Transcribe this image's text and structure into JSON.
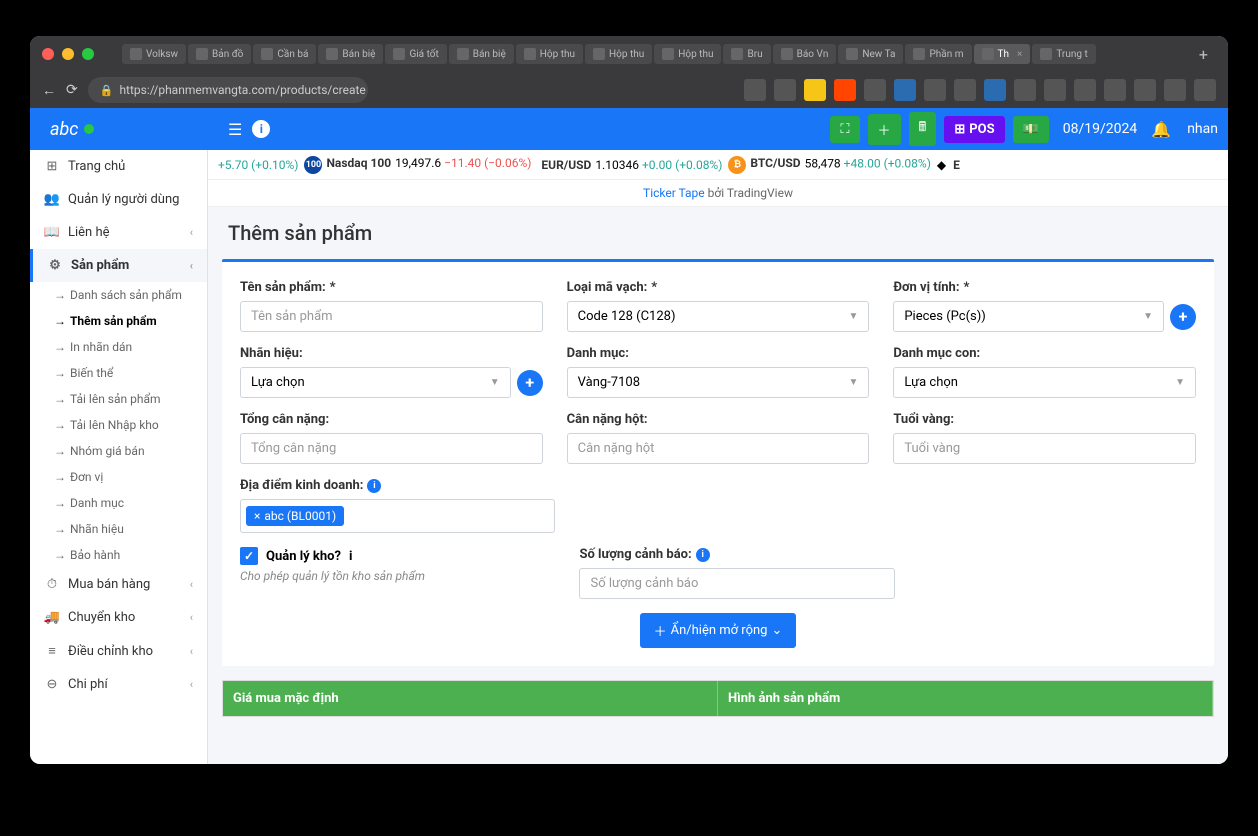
{
  "browser": {
    "tabs": [
      "Volksw",
      "Bản đồ",
      "Cần bá",
      "Bán biệ",
      "Giá tốt",
      "Bán biệ",
      "Hộp thu",
      "Hộp thu",
      "Hộp thu",
      "Bru",
      "Báo Vn",
      "New Ta",
      "Phần m",
      "Th",
      "Trung t"
    ],
    "active_tab_index": 13,
    "url": "https://phanmemvangta.com/products/create"
  },
  "header": {
    "logo": "abc",
    "date": "08/19/2024",
    "user": "nhan",
    "pos_label": "POS"
  },
  "ticker": {
    "items": [
      {
        "change": "+5.70",
        "pct": "(+0.10%)",
        "cls": "up"
      },
      {
        "badge": "100",
        "sym": "Nasdaq 100",
        "price": "19,497.6",
        "change": "−11.40",
        "pct": "(−0.06%)",
        "cls": "down"
      },
      {
        "sym": "EUR/USD",
        "price": "1.10346",
        "change": "+0.00",
        "pct": "(+0.08%)",
        "cls": "up"
      },
      {
        "badge": "₿",
        "sym": "BTC/USD",
        "price": "58,478",
        "change": "+48.00",
        "pct": "(+0.08%)",
        "cls": "up"
      }
    ],
    "caption_link": "Ticker Tape",
    "caption_rest": " bởi TradingView"
  },
  "sidebar": {
    "items": [
      {
        "icon": "⊞",
        "label": "Trang chủ"
      },
      {
        "icon": "👥",
        "label": "Quản lý người dùng"
      },
      {
        "icon": "📖",
        "label": "Liên hệ",
        "chev": true
      },
      {
        "icon": "⚙",
        "label": "Sản phẩm",
        "chev": true,
        "active": true
      },
      {
        "icon": "⏱",
        "label": "Mua bán hàng",
        "chev": true
      },
      {
        "icon": "🚚",
        "label": "Chuyển kho",
        "chev": true
      },
      {
        "icon": "≡",
        "label": "Điều chỉnh kho",
        "chev": true
      },
      {
        "icon": "⊖",
        "label": "Chi phí",
        "chev": true
      }
    ],
    "subs": [
      {
        "label": "Danh sách sản phẩm"
      },
      {
        "label": "Thêm sản phẩm",
        "active": true
      },
      {
        "label": "In nhãn dán"
      },
      {
        "label": "Biến thể"
      },
      {
        "label": "Tải lên sản phẩm"
      },
      {
        "label": "Tải lên Nhập kho"
      },
      {
        "label": "Nhóm giá bán"
      },
      {
        "label": "Đơn vị"
      },
      {
        "label": "Danh mục"
      },
      {
        "label": "Nhãn hiệu"
      },
      {
        "label": "Bảo hành"
      }
    ]
  },
  "page": {
    "title": "Thêm sản phẩm",
    "fields": {
      "ten_sp": {
        "label": "Tên sản phẩm:",
        "req": "*",
        "placeholder": "Tên sản phẩm"
      },
      "loai_ma": {
        "label": "Loại mã vạch:",
        "req": "*",
        "value": "Code 128 (C128)"
      },
      "don_vi": {
        "label": "Đơn vị tính:",
        "req": "*",
        "value": "Pieces (Pc(s))"
      },
      "nhan_hieu": {
        "label": "Nhãn hiệu:",
        "value": "Lựa chọn"
      },
      "danh_muc": {
        "label": "Danh mục:",
        "value": "Vàng-7108"
      },
      "danh_muc_con": {
        "label": "Danh mục con:",
        "value": "Lựa chọn"
      },
      "tong_can": {
        "label": "Tổng cân nặng:",
        "placeholder": "Tổng cân nặng"
      },
      "can_hot": {
        "label": "Cân nặng hột:",
        "placeholder": "Cân nặng hột"
      },
      "tuoi_vang": {
        "label": "Tuổi vàng:",
        "placeholder": "Tuổi vàng"
      },
      "dia_diem": {
        "label": "Địa điểm kinh doanh:",
        "tag": "abc (BL0001)"
      },
      "quan_ly_kho": {
        "label": "Quản lý kho?",
        "hint": "Cho phép quản lý tồn kho sản phẩm"
      },
      "sl_canh_bao": {
        "label": "Số lượng cảnh báo:",
        "placeholder": "Số lượng cảnh báo"
      }
    },
    "expand_btn": "Ẩn/hiện mở rộng",
    "table": {
      "col1": "Giá mua mặc định",
      "col2": "Hình ảnh sản phẩm"
    }
  }
}
